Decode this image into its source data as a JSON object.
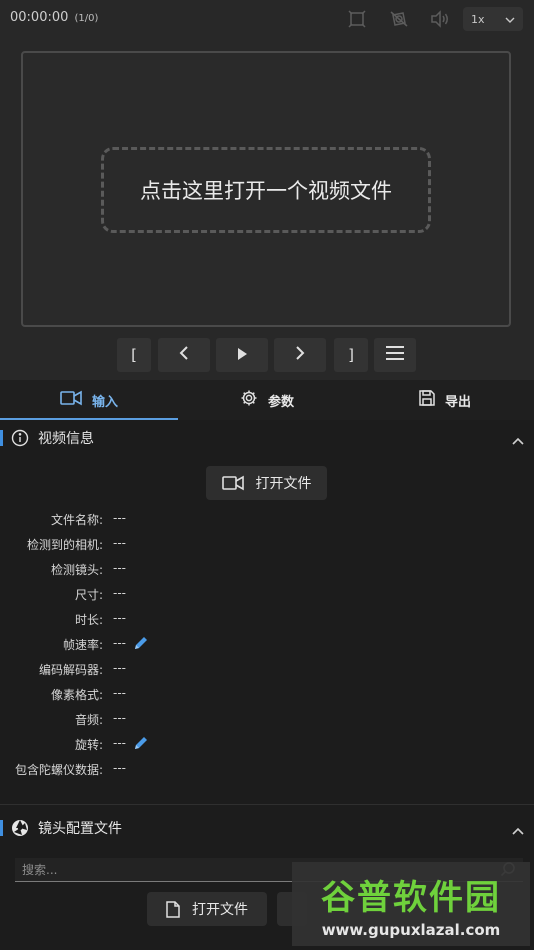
{
  "topbar": {
    "timecode": "00:00:00",
    "frames": "(1/0)",
    "speed": "1x",
    "icons": [
      "fullscreen-icon",
      "stabilize-icon",
      "volume-icon"
    ]
  },
  "viewer": {
    "prompt": "点击这里打开一个视频文件"
  },
  "controls": {
    "mark_in": "[",
    "mark_out": "]"
  },
  "tabs": [
    {
      "label": "输入",
      "icon": "camera-icon"
    },
    {
      "label": "参数",
      "icon": "gear-icon"
    },
    {
      "label": "导出",
      "icon": "save-icon"
    }
  ],
  "video_info": {
    "title": "视频信息",
    "open_button": "打开文件",
    "rows": [
      {
        "label": "文件名称:",
        "value": "---"
      },
      {
        "label": "检测到的相机:",
        "value": "---"
      },
      {
        "label": "检测镜头:",
        "value": "---"
      },
      {
        "label": "尺寸:",
        "value": "---"
      },
      {
        "label": "时长:",
        "value": "---"
      },
      {
        "label": "帧速率:",
        "value": "---"
      },
      {
        "label": "编码解码器:",
        "value": "---"
      },
      {
        "label": "像素格式:",
        "value": "---"
      },
      {
        "label": "音频:",
        "value": "---"
      },
      {
        "label": "旋转:",
        "value": "---"
      },
      {
        "label": "包含陀螺仪数据:",
        "value": "---"
      }
    ]
  },
  "lens_profile": {
    "title": "镜头配置文件",
    "search_placeholder": "搜索...",
    "open_button": "打开文件"
  },
  "watermark": {
    "text": "谷普软件园",
    "url": "www.gupuxlazal.com"
  },
  "colors": {
    "accent": "#5b9ee0",
    "background": "#282828",
    "panel": "#1c1c1c"
  }
}
